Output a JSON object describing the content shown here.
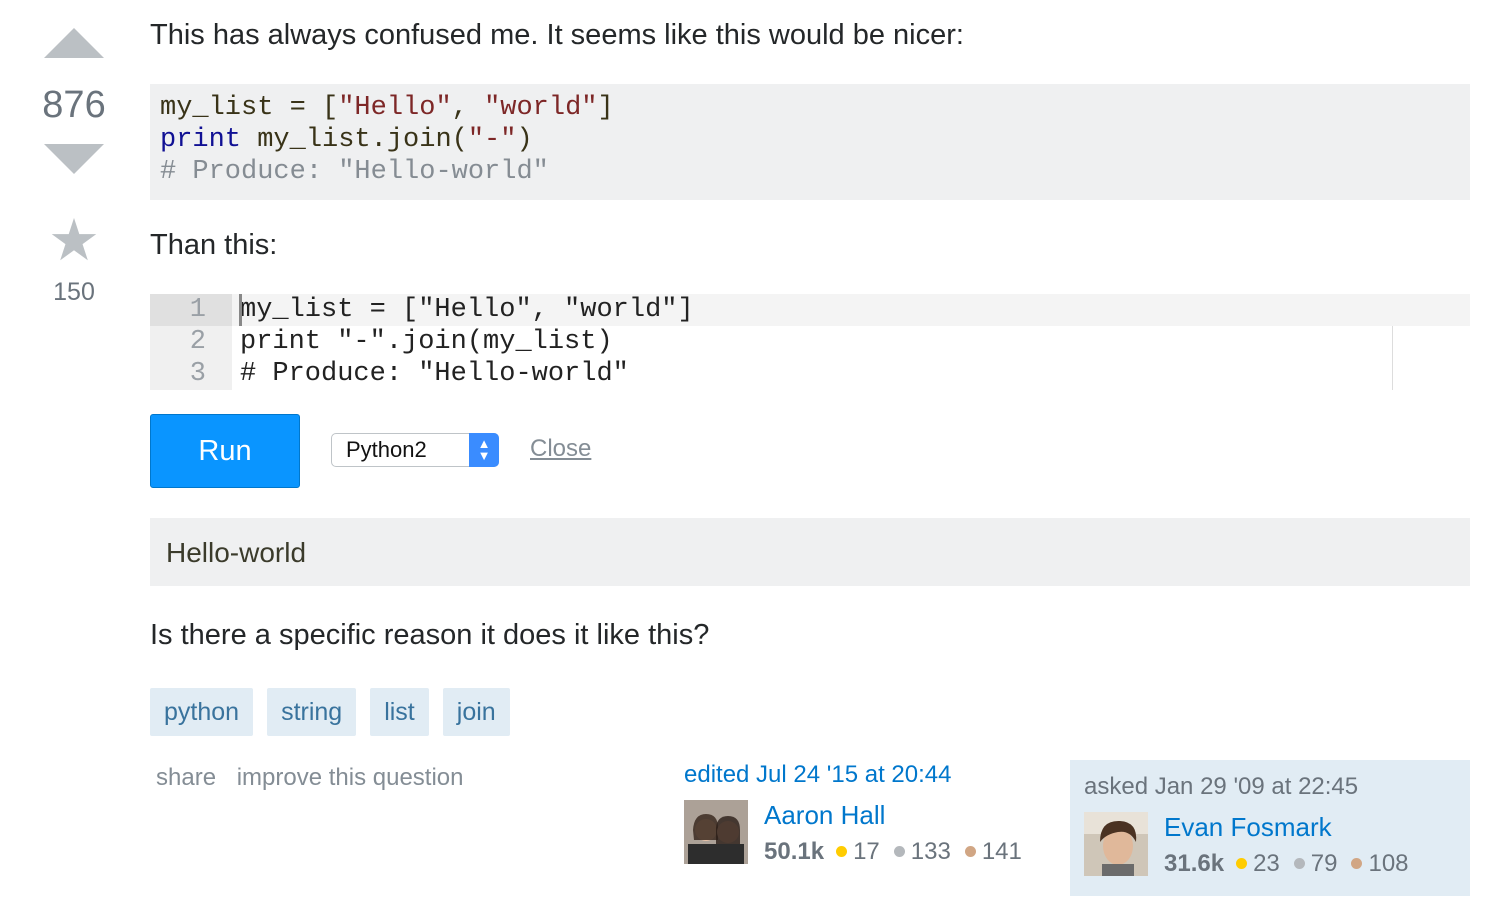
{
  "vote": {
    "score": "876",
    "favorites": "150",
    "up_icon": "up-arrow-icon",
    "down_icon": "down-arrow-icon",
    "star_icon": "star-icon"
  },
  "question": {
    "intro": "This has always confused me. It seems like this would be nicer:",
    "code_block_1": [
      {
        "parts": [
          {
            "t": "my_list = [",
            "c": "pln"
          },
          {
            "t": "\"Hello\"",
            "c": "str"
          },
          {
            "t": ", ",
            "c": "pln"
          },
          {
            "t": "\"world\"",
            "c": "str"
          },
          {
            "t": "]",
            "c": "pln"
          }
        ]
      },
      {
        "parts": [
          {
            "t": "print",
            "c": "kw"
          },
          {
            "t": " my_list.join(",
            "c": "pln"
          },
          {
            "t": "\"-\"",
            "c": "str"
          },
          {
            "t": ")",
            "c": "pln"
          }
        ]
      },
      {
        "parts": [
          {
            "t": "# Produce: \"Hello-world\"",
            "c": "com"
          }
        ]
      }
    ],
    "than_this": "Than this:",
    "editor": {
      "line_numbers": [
        "1",
        "2",
        "3"
      ],
      "lines": [
        "my_list = [\"Hello\", \"world\"]",
        "print \"-\".join(my_list)",
        "# Produce: \"Hello-world\""
      ]
    },
    "run_label": "Run",
    "language": "Python2",
    "close_label": "Close",
    "output": "Hello-world",
    "closing": "Is there a specific reason it does it like this?",
    "tags": [
      "python",
      "string",
      "list",
      "join"
    ]
  },
  "menu": {
    "share": "share",
    "improve": "improve this question"
  },
  "edited": {
    "action": "edited Jul 24 '15 at 20:44",
    "name": "Aaron Hall",
    "rep": "50.1k",
    "gold": "17",
    "silver": "133",
    "bronze": "141"
  },
  "asked": {
    "action": "asked Jan 29 '09 at 22:45",
    "name": "Evan Fosmark",
    "rep": "31.6k",
    "gold": "23",
    "silver": "79",
    "bronze": "108"
  },
  "colors": {
    "accent": "#0a95ff",
    "tag_bg": "#e1ecf4",
    "tag_fg": "#39739d",
    "link": "#0077cc"
  }
}
